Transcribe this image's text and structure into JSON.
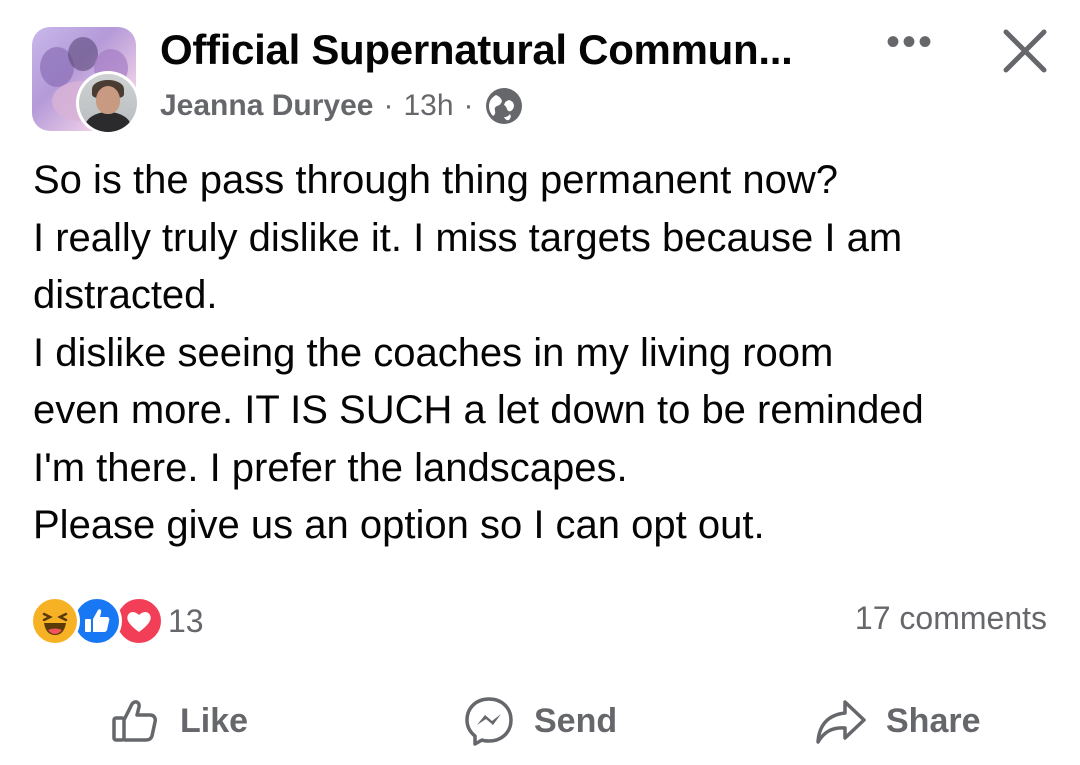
{
  "header": {
    "group_name": "Official Supernatural Commun...",
    "author": "Jeanna Duryee",
    "separator": "·",
    "time": "13h",
    "privacy_icon": "globe-icon",
    "more_icon": "more-horizontal-icon",
    "more_label": "•••",
    "close_icon": "close-icon"
  },
  "post": {
    "lines": [
      "So is the pass through thing permanent now?",
      "I really truly dislike it. I miss targets because I am",
      "distracted.",
      "I dislike seeing the coaches in my living room",
      "even more. IT IS SUCH a let down to be reminded",
      "I'm there. I prefer the landscapes.",
      "Please give us an option so I can opt out."
    ]
  },
  "reactions": {
    "icons": [
      "haha-icon",
      "like-icon",
      "love-icon"
    ],
    "count": "13",
    "comments": "17 comments"
  },
  "actions": [
    {
      "label": "Like",
      "icon": "thumbs-up-icon"
    },
    {
      "label": "Send",
      "icon": "messenger-icon"
    },
    {
      "label": "Share",
      "icon": "share-arrow-icon"
    }
  ],
  "colors": {
    "text_primary": "#050505",
    "text_secondary": "#65676b",
    "like_blue": "#1877f2",
    "love_red": "#f33e58",
    "haha_yellow": "#f7b125"
  }
}
